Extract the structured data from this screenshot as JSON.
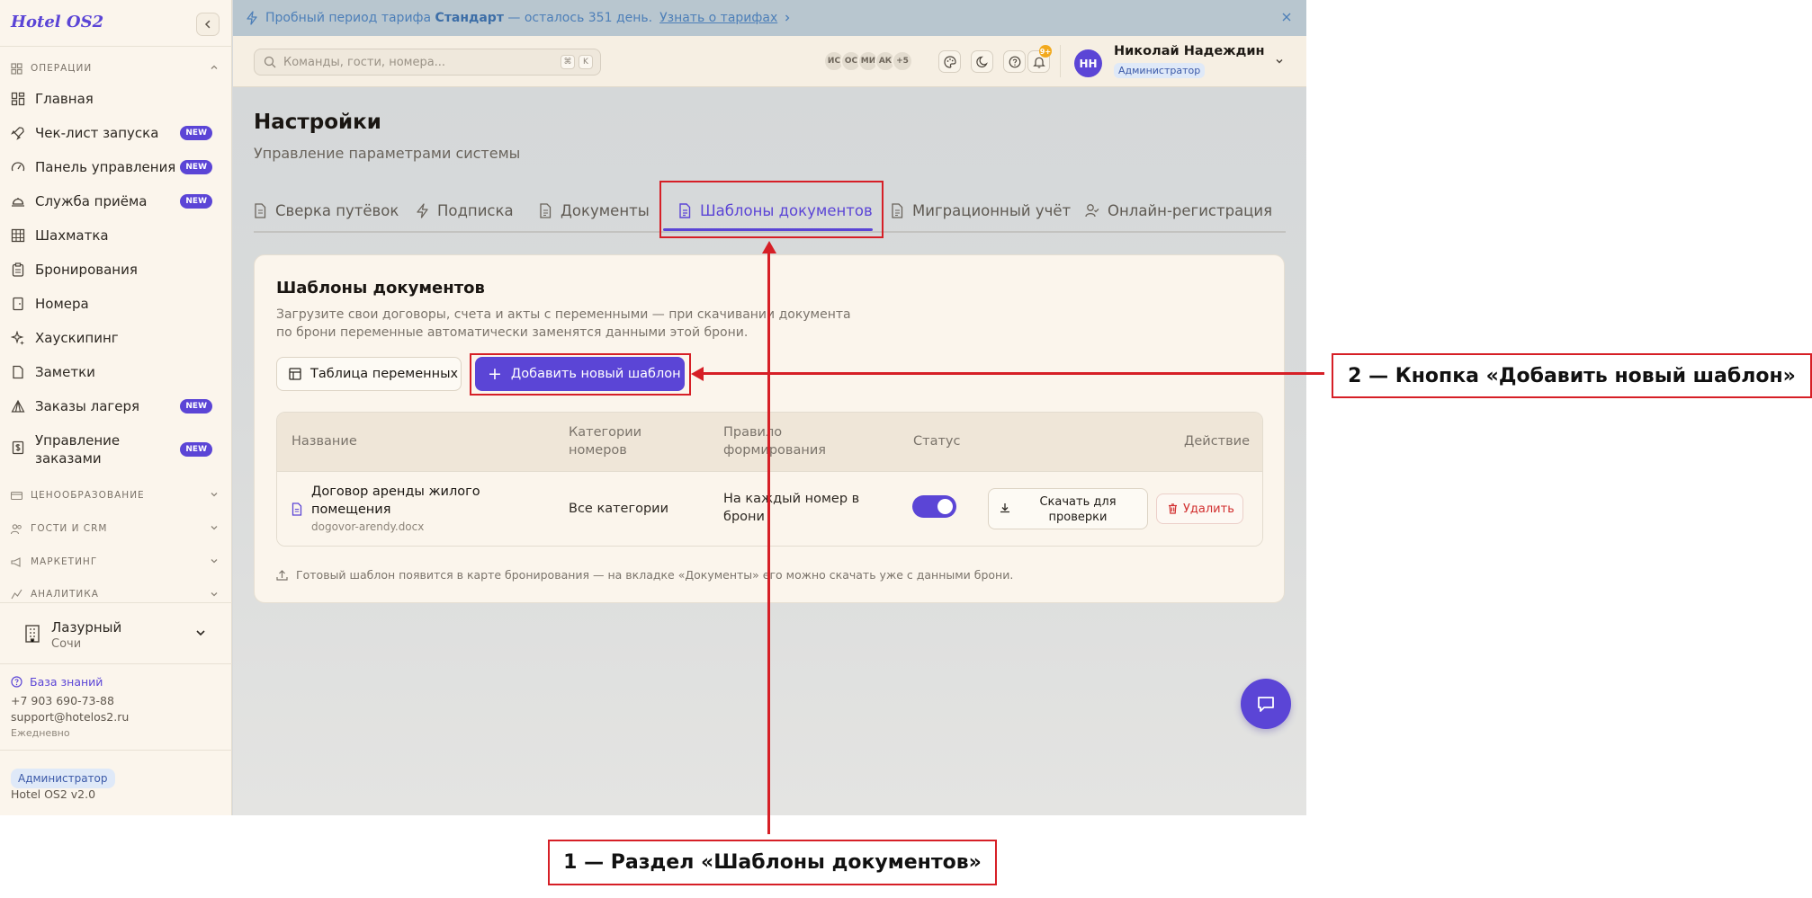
{
  "brand": "Hotel OS2",
  "sidebar": {
    "groups": {
      "operations": "ОПЕРАЦИИ",
      "pricing": "ЦЕНООБРАЗОВАНИЕ",
      "guests": "ГОСТИ И CRM",
      "marketing": "МАРКЕТИНГ",
      "analytics": "АНАЛИТИКА"
    },
    "items": [
      {
        "label": "Главная",
        "icon": "dashboard-icon",
        "badge": ""
      },
      {
        "label": "Чек-лист запуска",
        "icon": "rocket-icon",
        "badge": "NEW"
      },
      {
        "label": "Панель управления",
        "icon": "gauge-icon",
        "badge": "NEW"
      },
      {
        "label": "Служба приёма",
        "icon": "bell-desk-icon",
        "badge": "NEW"
      },
      {
        "label": "Шахматка",
        "icon": "grid-icon",
        "badge": ""
      },
      {
        "label": "Бронирования",
        "icon": "clipboard-icon",
        "badge": ""
      },
      {
        "label": "Номера",
        "icon": "door-icon",
        "badge": ""
      },
      {
        "label": "Хаускипинг",
        "icon": "sparkles-icon",
        "badge": ""
      },
      {
        "label": "Заметки",
        "icon": "note-icon",
        "badge": ""
      },
      {
        "label": "Заказы лагеря",
        "icon": "tent-icon",
        "badge": "NEW"
      },
      {
        "label_line1": "Управление",
        "label_line2": "заказами",
        "icon": "receipt-icon",
        "badge": "NEW"
      }
    ],
    "hotel": {
      "name": "Лазурный",
      "city": "Сочи"
    },
    "knowledge_base": "База знаний",
    "phone": "+7 903 690-73-88",
    "email": "support@hotelos2.ru",
    "schedule": "Ежедневно",
    "role": "Администратор",
    "version": "Hotel OS2 v2.0"
  },
  "banner": {
    "text_before": "Пробный период тарифа",
    "plan": "Стандарт",
    "text_after": "— осталось 351 день.",
    "link": "Узнать о тарифах"
  },
  "topbar": {
    "search_placeholder": "Команды, гости, номера...",
    "kbd_1": "⌘",
    "kbd_2": "K",
    "avatars": [
      "ИС",
      "ОС",
      "МИ",
      "АК",
      "+5"
    ],
    "notifications_count": "9+",
    "user_initials": "НН",
    "user_name": "Николай Надеждин",
    "user_role": "Администратор"
  },
  "page": {
    "title": "Настройки",
    "subtitle": "Управление параметрами системы",
    "tabs": [
      {
        "label": "Сверка путёвок",
        "icon": "file-icon",
        "active": false
      },
      {
        "label": "Подписка",
        "icon": "bolt-icon",
        "active": false
      },
      {
        "label": "Документы",
        "icon": "document-icon",
        "active": false
      },
      {
        "label": "Шаблоны документов",
        "icon": "document-template-icon",
        "active": true
      },
      {
        "label": "Миграционный учёт",
        "icon": "document-icon",
        "active": false
      },
      {
        "label": "Онлайн-регистрация",
        "icon": "user-check-icon",
        "active": false
      }
    ]
  },
  "card": {
    "title": "Шаблоны документов",
    "description": "Загрузите свои договоры, счета и акты с переменными — при скачивании документа по брони переменные автоматически заменятся данными этой брони.",
    "vars_button": "Таблица переменных",
    "add_button": "Добавить новый шаблон",
    "columns": {
      "name": "Название",
      "categories_1": "Категории",
      "categories_2": "номеров",
      "rule_1": "Правило",
      "rule_2": "формирования",
      "status": "Статус",
      "action": "Действие"
    },
    "rows": [
      {
        "name_1": "Договор аренды жилого",
        "name_2": "помещения",
        "file": "dogovor-arendy.docx",
        "categories": "Все категории",
        "rule_1": "На каждый номер в",
        "rule_2": "брони",
        "enabled": true,
        "download_1": "Скачать для",
        "download_2": "проверки",
        "delete": "Удалить"
      }
    ],
    "hint": "Готовый шаблон появится в карте бронирования — на вкладке «Документы» его можно скачать уже с данными брони."
  },
  "annotations": {
    "callout_1": "1 — Раздел «Шаблоны документов»",
    "callout_2": "2 — Кнопка «Добавить новый шаблон»",
    "color": "#d61f26"
  },
  "colors": {
    "accent": "#5b45d6",
    "sidebar_bg": "#fbf5ec",
    "banner_bg": "#b8c6cf",
    "danger": "#d12f2f"
  }
}
